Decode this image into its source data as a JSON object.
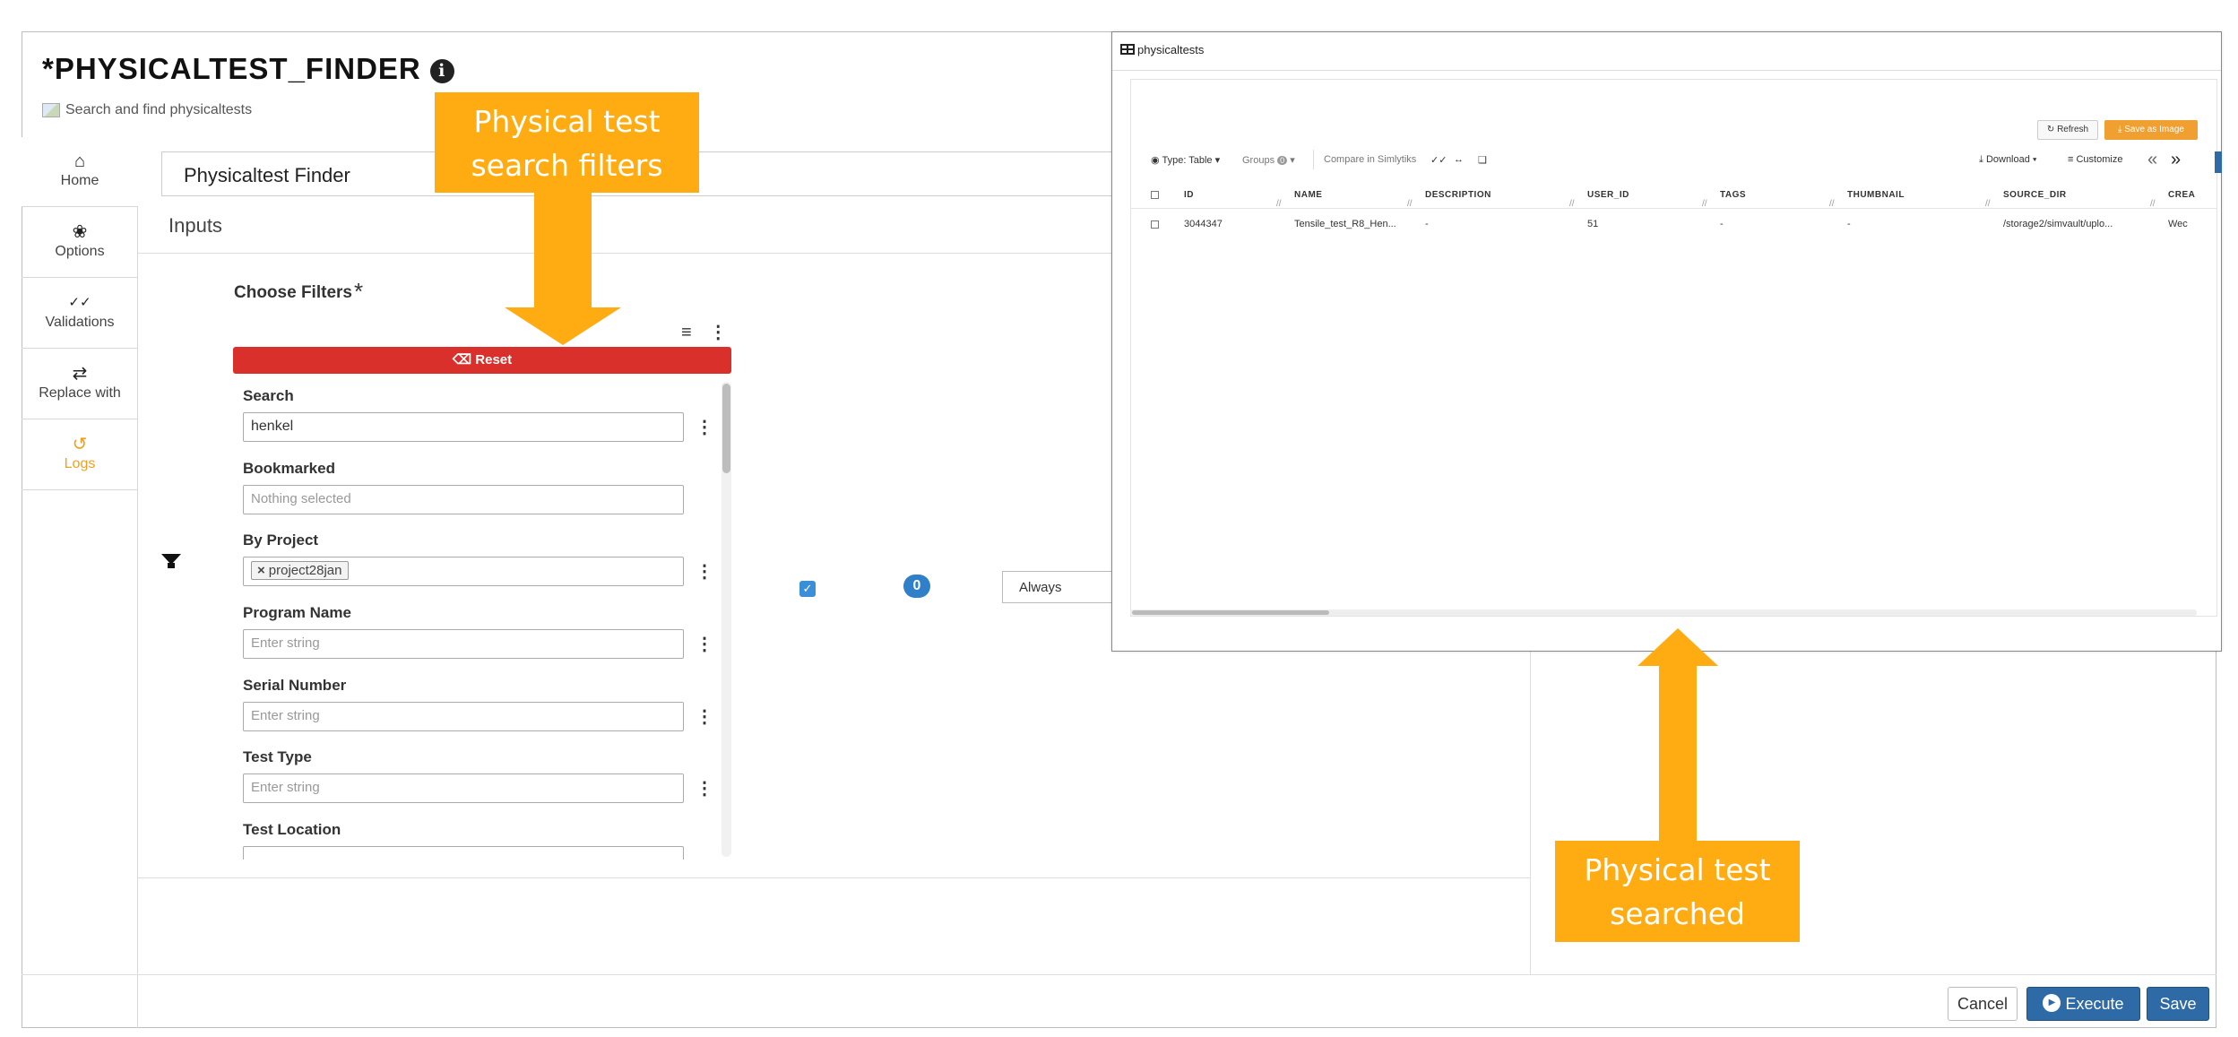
{
  "header": {
    "title": "*PHYSICALTEST_FINDER",
    "info_icon": "info-icon",
    "subtitle": "Search and find physicaltests"
  },
  "sidebar": {
    "items": [
      {
        "label": "Home",
        "icon": "home-icon"
      },
      {
        "label": "Options",
        "icon": "gear-icon"
      },
      {
        "label": "Validations",
        "icon": "double-check-icon"
      },
      {
        "label": "Replace with",
        "icon": "swap-arrows-icon"
      },
      {
        "label": "Logs",
        "icon": "history-icon"
      }
    ]
  },
  "main": {
    "finder_name": "Physicaltest Finder",
    "inputs_label": "Inputs",
    "choose_filters_label": "Choose Filters",
    "required_mark": "*",
    "reset_label": "Reset",
    "filters": [
      {
        "label": "Search",
        "value": "henkel",
        "placeholder": ""
      },
      {
        "label": "Bookmarked",
        "value": "",
        "placeholder": "Nothing selected"
      },
      {
        "label": "By Project",
        "value": "project28jan",
        "placeholder": ""
      },
      {
        "label": "Program Name",
        "value": "",
        "placeholder": "Enter string"
      },
      {
        "label": "Serial Number",
        "value": "",
        "placeholder": "Enter string"
      },
      {
        "label": "Test Type",
        "value": "",
        "placeholder": "Enter string"
      },
      {
        "label": "Test Location",
        "value": "",
        "placeholder": ""
      }
    ],
    "badge_count": "0",
    "condition_value": "Always"
  },
  "footer": {
    "cancel_label": "Cancel",
    "execute_label": "Execute",
    "save_label": "Save"
  },
  "results_window": {
    "title": "physicaltests",
    "refresh_label": "Refresh",
    "save_image_label": "Save as Image",
    "toolbar": {
      "type_label": "Type: Table",
      "groups_label": "Groups",
      "groups_count": "0",
      "compare_label": "Compare in Simlytiks",
      "download_label": "Download",
      "customize_label": "Customize"
    },
    "columns": [
      "ID",
      "NAME",
      "DESCRIPTION",
      "USER_ID",
      "TAGS",
      "THUMBNAIL",
      "SOURCE_DIR",
      "CREA"
    ],
    "rows": [
      [
        "3044347",
        "Tensile_test_R8_Hen...",
        "-",
        "51",
        "-",
        "-",
        "/storage2/simvault/uplo...",
        "Wec"
      ]
    ]
  },
  "annotations": {
    "top": [
      "Physical test",
      "search filters"
    ],
    "bottom": [
      "Physical test",
      "searched"
    ]
  },
  "colors": {
    "accent_orange": "#ffac13",
    "reset_red": "#d9302b",
    "primary_blue": "#2d6aa6",
    "logs_orange": "#f0a020"
  }
}
